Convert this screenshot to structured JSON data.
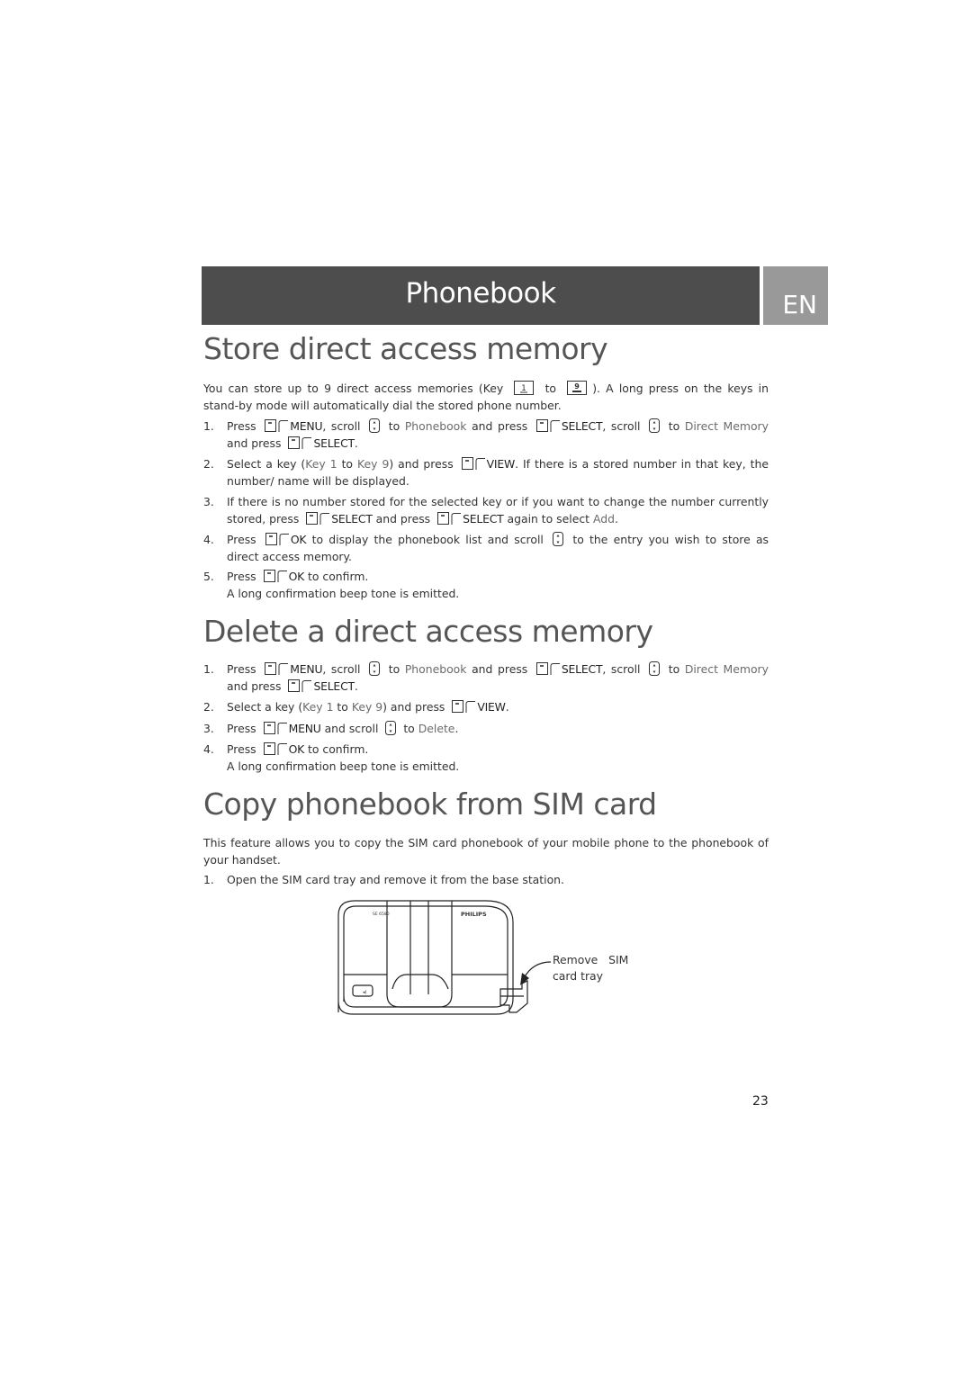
{
  "header": {
    "title": "Phonebook",
    "language": "EN"
  },
  "sections": [
    {
      "heading": "Store direct access memory",
      "intro": {
        "before": "You can store up to 9 direct access memories (Key",
        "key_from": "1",
        "mid": "to",
        "key_to": "9",
        "after": "). A long press on the keys in stand-by mode will automatically dial the stored phone number."
      },
      "steps": [
        {
          "num": "1.",
          "t1": "Press",
          "k1": "MENU",
          "t2": ", scroll",
          "t3": "to",
          "h1": "Phonebook",
          "t4": "and press",
          "k2": "SELECT",
          "t5": ", scroll",
          "t6": "to",
          "h2": "Direct Memory",
          "t7": "and press",
          "k3": "SELECT",
          "t8": "."
        },
        {
          "num": "2.",
          "t1": "Select a key (",
          "h1": "Key 1",
          "t2": "to",
          "h2": "Key 9",
          "t3": ") and press",
          "k1": "VIEW",
          "t4": ". If there is a stored number in that key, the number/ name will be displayed."
        },
        {
          "num": "3.",
          "t1": "If there is no number stored for the selected key or if you want to change the number currently stored, press",
          "k1": "SELECT",
          "t2": "and press",
          "k2": "SELECT",
          "t3": "again to select",
          "h1": "Add",
          "t4": "."
        },
        {
          "num": "4.",
          "t1": "Press",
          "k1": "OK",
          "t2": "to display the phonebook list and scroll",
          "t3": "to the entry you wish to store as direct access memory."
        },
        {
          "num": "5.",
          "t1": "Press",
          "k1": "OK",
          "t2": "to confirm.",
          "note": "A long confirmation beep tone is emitted."
        }
      ]
    },
    {
      "heading": "Delete a direct access memory",
      "steps": [
        {
          "num": "1.",
          "t1": "Press",
          "k1": "MENU",
          "t2": ", scroll",
          "t3": "to",
          "h1": "Phonebook",
          "t4": "and press",
          "k2": "SELECT",
          "t5": ", scroll",
          "t6": "to",
          "h2": "Direct Memory",
          "t7": "and press",
          "k3": "SELECT",
          "t8": "."
        },
        {
          "num": "2.",
          "t1": "Select a key (",
          "h1": "Key 1",
          "t2": "to",
          "h2": "Key 9",
          "t3": ") and press",
          "k1": "VIEW",
          "t4": "."
        },
        {
          "num": "3.",
          "t1": "Press",
          "k1": "MENU",
          "t2": "and scroll",
          "t3": "to",
          "h1": "Delete",
          "t4": "."
        },
        {
          "num": "4.",
          "t1": "Press",
          "k1": "OK",
          "t2": "to confirm.",
          "note": "A long confirmation beep tone is emitted."
        }
      ]
    },
    {
      "heading": "Copy phonebook from SIM card",
      "intro": "This feature allows you to copy the SIM card phonebook of your mobile phone to the phonebook of your handset.",
      "steps": [
        {
          "num": "1.",
          "t1": "Open the SIM card tray and remove it from the base station."
        }
      ]
    }
  ],
  "figure": {
    "brand": "PHILIPS",
    "model": "SE 6580",
    "caption_line1": "Remove   SIM",
    "caption_line2": "card tray"
  },
  "page_number": "23"
}
